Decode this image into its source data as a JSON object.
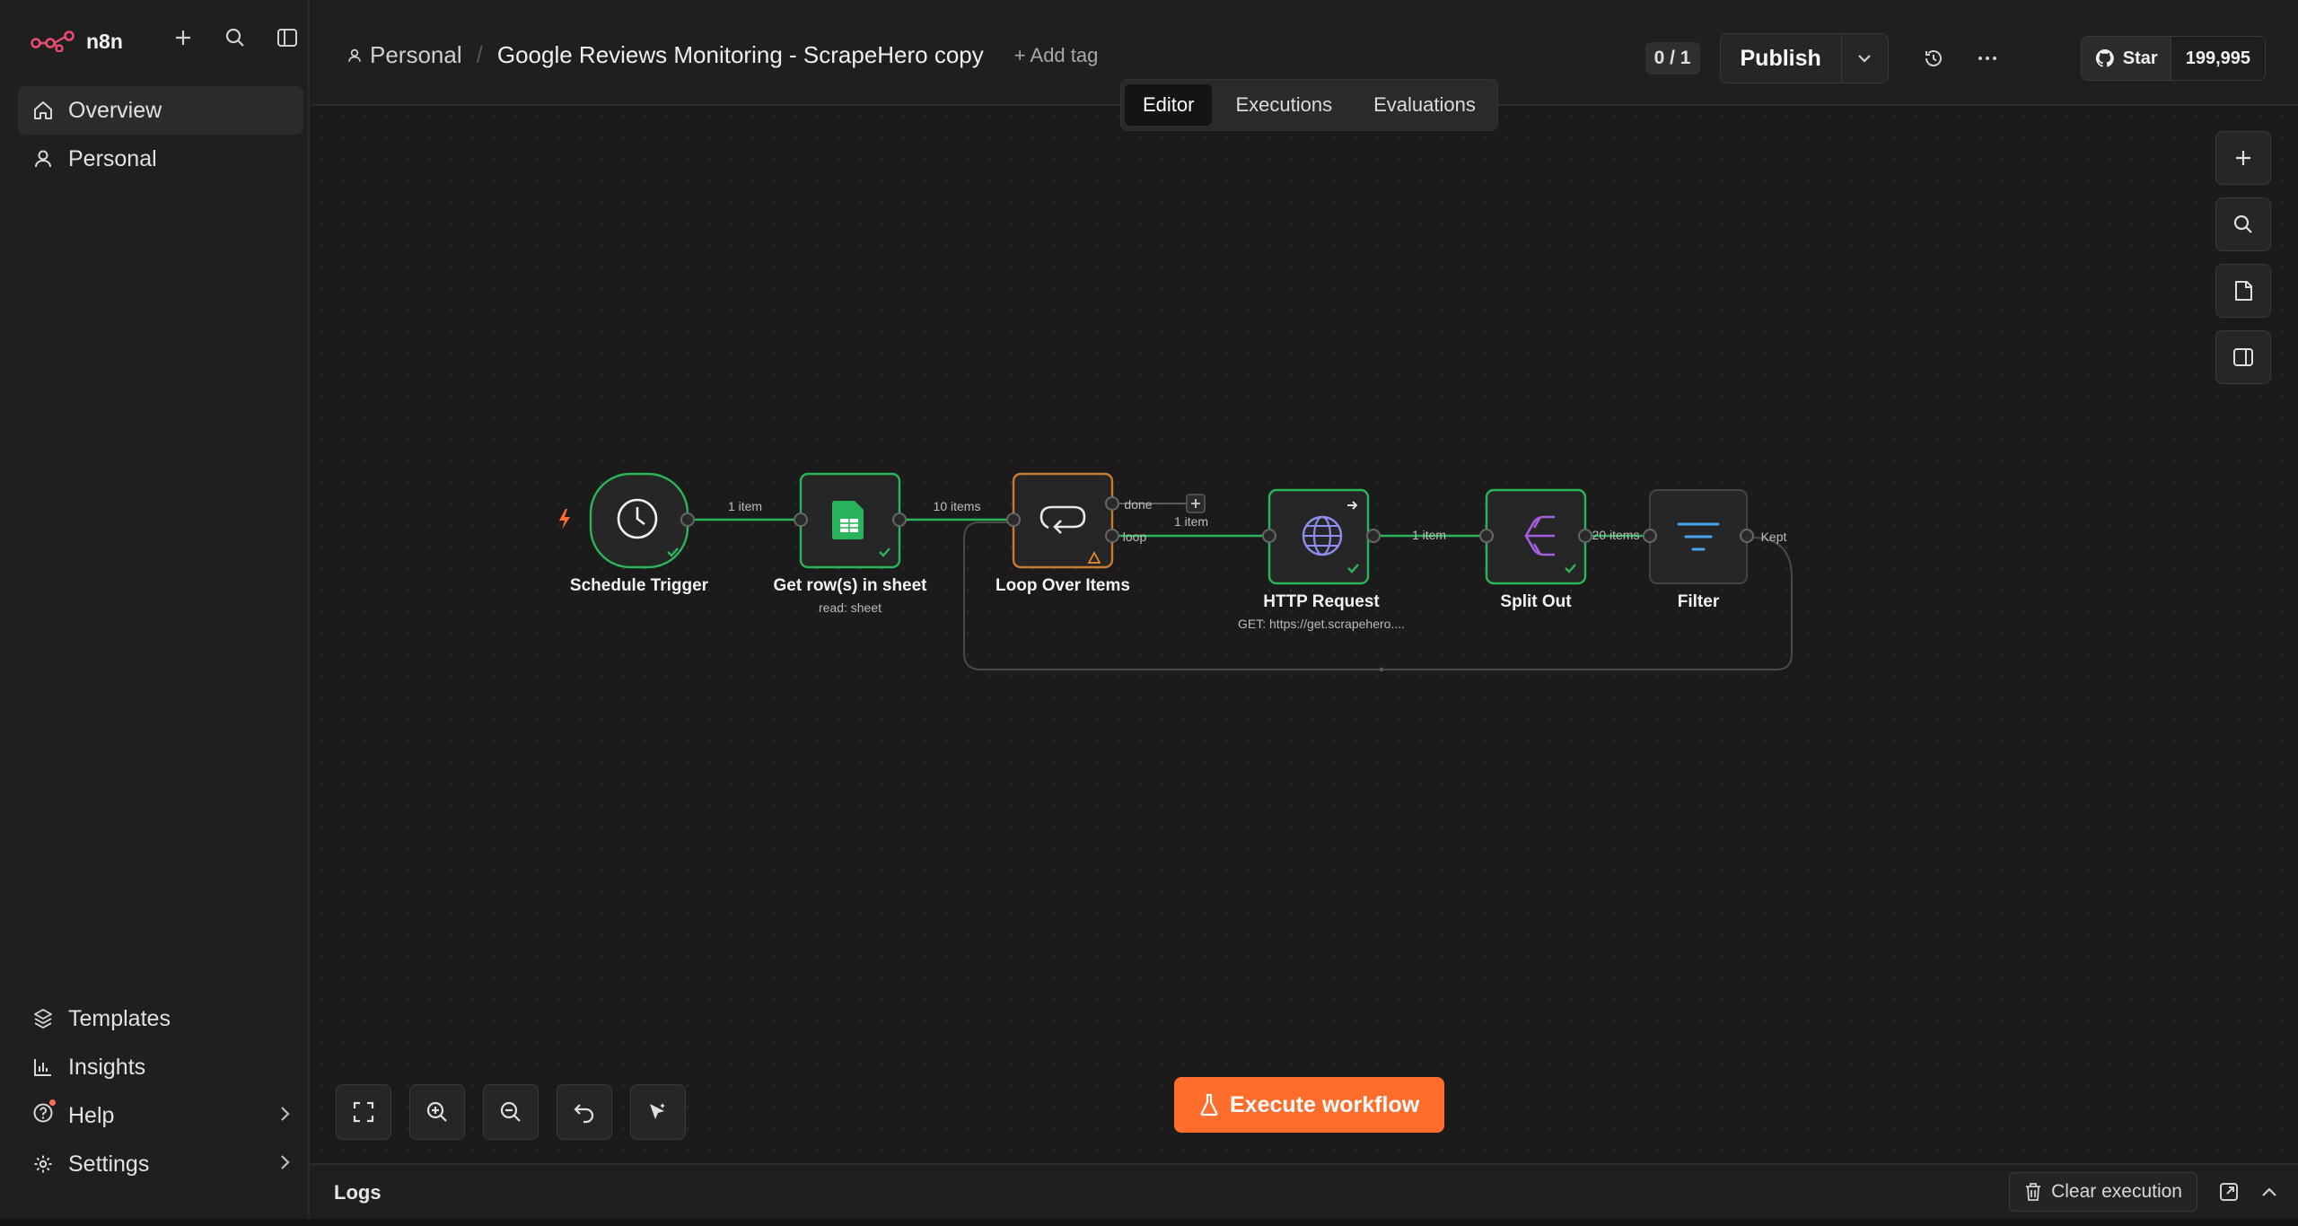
{
  "app": {
    "logo_text": "n8n"
  },
  "sidebar": {
    "top_items": [
      {
        "label": "Overview",
        "icon": "home-icon"
      },
      {
        "label": "Personal",
        "icon": "user-icon"
      }
    ],
    "bottom_items": [
      {
        "label": "Templates",
        "icon": "templates-icon"
      },
      {
        "label": "Insights",
        "icon": "insights-icon"
      },
      {
        "label": "Help",
        "icon": "help-icon"
      },
      {
        "label": "Settings",
        "icon": "settings-icon"
      }
    ]
  },
  "header": {
    "breadcrumb_project": "Personal",
    "workflow_title": "Google Reviews Monitoring - ScrapeHero copy",
    "add_tag": "+ Add tag",
    "counter": "0 / 1",
    "publish_label": "Publish",
    "github_star": "Star",
    "github_count": "199,995"
  },
  "tabs": [
    {
      "label": "Editor",
      "active": true
    },
    {
      "label": "Executions",
      "active": false
    },
    {
      "label": "Evaluations",
      "active": false
    }
  ],
  "nodes": [
    {
      "id": "schedule",
      "label": "Schedule Trigger",
      "sub": "",
      "icon": "clock-icon"
    },
    {
      "id": "sheet",
      "label": "Get row(s) in sheet",
      "sub": "read: sheet",
      "icon": "sheets-icon"
    },
    {
      "id": "loop",
      "label": "Loop Over Items",
      "sub": "",
      "icon": "loop-icon"
    },
    {
      "id": "http",
      "label": "HTTP Request",
      "sub": "GET: https://get.scrapehero....",
      "icon": "globe-icon"
    },
    {
      "id": "split",
      "label": "Split Out",
      "sub": "",
      "icon": "split-icon"
    },
    {
      "id": "filter",
      "label": "Filter",
      "sub": "",
      "icon": "filter-icon"
    }
  ],
  "edges": {
    "trigger_to_sheet": "1 item",
    "sheet_to_loop": "10 items",
    "loop_done": "done",
    "loop_loop": "loop",
    "loop_to_http": "1 item",
    "http_to_split": "1 item",
    "split_to_filter": "20 items",
    "filter_kept": "Kept"
  },
  "execute_label": "Execute workflow",
  "logs": {
    "title": "Logs",
    "clear_label": "Clear execution"
  },
  "colors": {
    "accent": "#ff6d2c",
    "success": "#2cb45a",
    "warning": "#e38b2a"
  }
}
